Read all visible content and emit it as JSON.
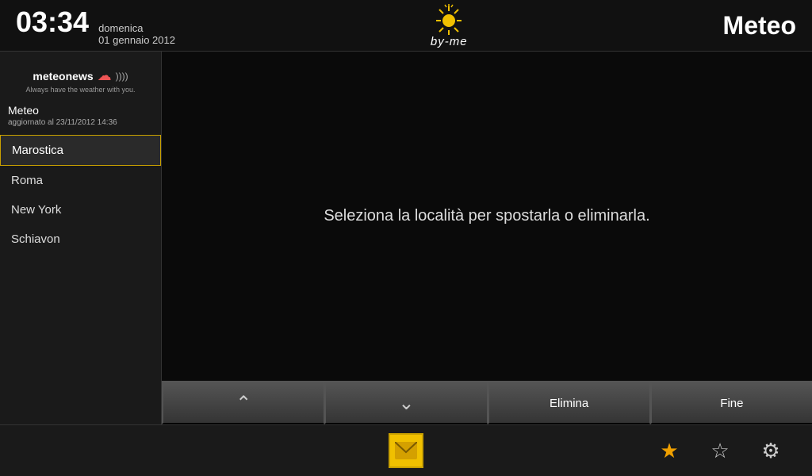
{
  "topbar": {
    "clock": "03:34",
    "day": "domenica",
    "date": "01 gennaio 2012",
    "title": "Meteo"
  },
  "byme": {
    "tagline": "by-me"
  },
  "sidebar": {
    "brand": "meteonews",
    "tagline": "Always have the weather with you.",
    "section_label": "Meteo",
    "updated": "aggiornato al 23/11/2012 14:36",
    "locations": [
      {
        "id": "marostica",
        "label": "Marostica",
        "selected": true
      },
      {
        "id": "roma",
        "label": "Roma",
        "selected": false
      },
      {
        "id": "new-york",
        "label": "New York",
        "selected": false
      },
      {
        "id": "schiavon",
        "label": "Schiavon",
        "selected": false
      }
    ]
  },
  "content": {
    "instruction": "Seleziona la località per spostarla o eliminarla."
  },
  "actionbar": {
    "up_label": "▲",
    "down_label": "▼",
    "delete_label": "Elimina",
    "done_label": "Fine"
  },
  "bottomnav": {
    "envelope_icon": "✉",
    "star_filled_icon": "★",
    "star_outline_icon": "☆",
    "gear_icon": "⚙"
  }
}
